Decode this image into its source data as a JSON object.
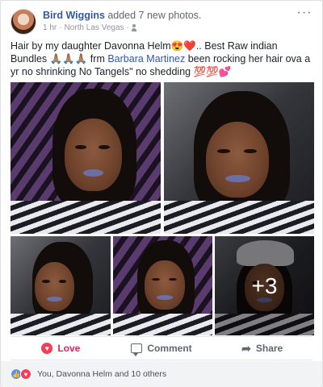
{
  "post": {
    "author": "Bird Wiggins",
    "action": "added 7 new photos.",
    "time": "1 hr",
    "location": "North Las Vegas",
    "audience_icon": "friends-icon",
    "more_icon": "···",
    "text_part1": "Hair by my daughter Davonna Helm😍❤️.. Best Raw indian Bundles 🙏🏽🙏🏽🙏🏽 frm ",
    "mention": "Barbara Martinez",
    "text_part2": " been rocking her hair ova a yr no shrinking No Tangels\" no shedding 💯💯💕"
  },
  "photos": {
    "extra_count": "+3"
  },
  "actions": {
    "love_label": "Love",
    "comment_label": "Comment",
    "share_label": "Share"
  },
  "reactions": {
    "summary": "You, Davonna Helm and 10 others",
    "types": [
      "like",
      "love"
    ]
  },
  "colors": {
    "link": "#365899",
    "love": "#f33e58",
    "like": "#5890ff"
  }
}
